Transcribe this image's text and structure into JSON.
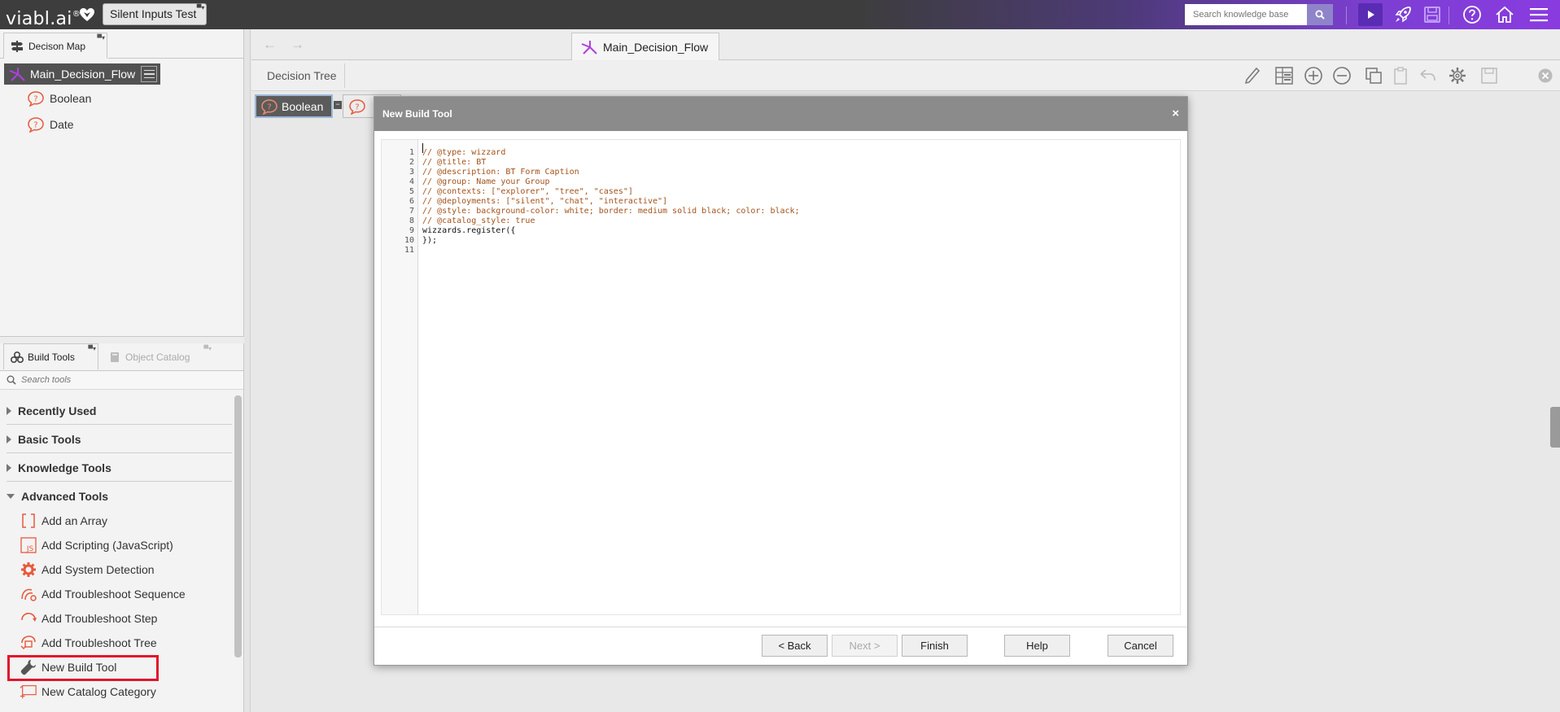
{
  "app": {
    "logo_text": "viabl.ai",
    "logo_reg": "®",
    "project_name": "Silent Inputs Test",
    "search_placeholder": "Search knowledge base"
  },
  "colors": {
    "accent_purple": "#8a3be0",
    "topbar_dark": "#3d3d3d",
    "icon_orange": "#e8593c",
    "highlight_red": "#e0162b"
  },
  "decision_map": {
    "tab_label": "Decison Map",
    "root_label": "Main_Decision_Flow",
    "nodes": [
      {
        "label": "Boolean",
        "icon": "question-icon"
      },
      {
        "label": "Date",
        "icon": "question-icon"
      }
    ]
  },
  "build_tools": {
    "tab_label": "Build Tools",
    "other_tab_label": "Object Catalog",
    "search_placeholder": "Search tools",
    "groups": [
      {
        "label": "Recently Used",
        "expanded": false
      },
      {
        "label": "Basic Tools",
        "expanded": false
      },
      {
        "label": "Knowledge Tools",
        "expanded": false
      },
      {
        "label": "Advanced Tools",
        "expanded": true
      }
    ],
    "advanced_items": [
      {
        "label": "Add an Array",
        "icon": "array-icon"
      },
      {
        "label": "Add Scripting (JavaScript)",
        "icon": "js-icon"
      },
      {
        "label": "Add System Detection",
        "icon": "gear-icon"
      },
      {
        "label": "Add Troubleshoot Sequence",
        "icon": "sequence-icon"
      },
      {
        "label": "Add Troubleshoot Step",
        "icon": "step-icon"
      },
      {
        "label": "Add Troubleshoot Tree",
        "icon": "tree-icon"
      },
      {
        "label": "New Build Tool",
        "icon": "wrench-icon"
      },
      {
        "label": "New Catalog Category",
        "icon": "catalog-icon"
      }
    ]
  },
  "main": {
    "flow_tab_label": "Main_Decision_Flow",
    "toolbar_label": "Decision Tree",
    "canvas_node_label": "Boolean"
  },
  "modal": {
    "title": "New Build Tool",
    "close": "×",
    "code_lines": [
      {
        "n": "1",
        "text": "// @type: wizzard",
        "kind": "comment"
      },
      {
        "n": "2",
        "text": "// @title: BT",
        "kind": "comment"
      },
      {
        "n": "3",
        "text": "// @description: BT Form Caption",
        "kind": "comment"
      },
      {
        "n": "4",
        "text": "// @group: Name your Group",
        "kind": "comment"
      },
      {
        "n": "5",
        "text": "// @contexts: [\"explorer\", \"tree\", \"cases\"]",
        "kind": "comment"
      },
      {
        "n": "6",
        "text": "// @deployments: [\"silent\", \"chat\", \"interactive\"]",
        "kind": "comment"
      },
      {
        "n": "7",
        "text": "// @style: background-color: white; border: medium solid black; color: black;",
        "kind": "comment"
      },
      {
        "n": "8",
        "text": "// @catalog_style: true",
        "kind": "comment"
      },
      {
        "n": "9",
        "text": "wizzards.register({",
        "kind": "code"
      },
      {
        "n": "10",
        "text": "});",
        "kind": "code"
      },
      {
        "n": "11",
        "text": "",
        "kind": "code"
      }
    ],
    "buttons": {
      "back": "< Back",
      "next": "Next >",
      "finish": "Finish",
      "help": "Help",
      "cancel": "Cancel"
    }
  }
}
